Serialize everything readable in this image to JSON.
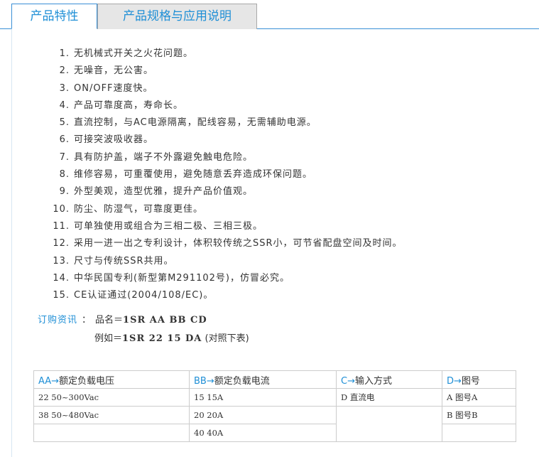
{
  "tabs": [
    {
      "label": "产品特性",
      "active": true
    },
    {
      "label": "产品规格与应用说明",
      "active": false
    }
  ],
  "features": [
    {
      "num": "1.",
      "text": "无机械式开关之火花问题。"
    },
    {
      "num": "2.",
      "text": "无噪音，无公害。"
    },
    {
      "num": "3.",
      "text": "ON/OFF速度快。"
    },
    {
      "num": "4.",
      "text": "产品可靠度高，寿命长。"
    },
    {
      "num": "5.",
      "text": "直流控制，与AC电源隔离，配线容易，无需辅助电源。"
    },
    {
      "num": "6.",
      "text": "可接突波吸收器。"
    },
    {
      "num": "7.",
      "text": "具有防护盖，端子不外露避免触电危险。"
    },
    {
      "num": "8.",
      "text": "维修容易，可重覆使用，避免随意丢弃造成环保问题。"
    },
    {
      "num": "9.",
      "text": "外型美观，造型优雅，提升产品价值观。"
    },
    {
      "num": "10.",
      "text": "防尘、防湿气，可靠度更佳。"
    },
    {
      "num": "11.",
      "text": "可单独使用或组合为三相二极、三相三极。"
    },
    {
      "num": "12.",
      "text": "采用一进一出之专利设计，体积较传统之SSR小，可节省配盘空间及时间。"
    },
    {
      "num": "13.",
      "text": "尺寸与传统SSR共用。"
    },
    {
      "num": "14.",
      "text": "中华民国专利(新型第M291102号)，仿冒必究。"
    },
    {
      "num": "15.",
      "text": "CE认证通过(2004/108/EC)。"
    }
  ],
  "order": {
    "label": "订购资讯",
    "colon": "：",
    "name_prefix": "品名＝",
    "name_code": "1SR AA BB CD",
    "example_prefix": "例如＝",
    "example_code": "1SR 22 15 DA",
    "example_note": "(对照下表)"
  },
  "spec_table": {
    "headers": [
      {
        "code": "AA→",
        "text": "额定负载电压"
      },
      {
        "code": "BB→",
        "text": "额定负载电流"
      },
      {
        "code": "C→",
        "text": "输入方式"
      },
      {
        "code": "D→",
        "text": "图号"
      }
    ],
    "rows": [
      [
        "22 50~300Vac",
        "15 15A",
        "D 直流电",
        "A 图号A"
      ],
      [
        "38 50~480Vac",
        "20 20A",
        "",
        "B 图号B"
      ],
      [
        "",
        "40 40A",
        "",
        ""
      ]
    ]
  },
  "colors": {
    "accent": "#1f8fd6",
    "border": "#cccccc",
    "tab_inactive_bg": "#e6e6e6"
  }
}
